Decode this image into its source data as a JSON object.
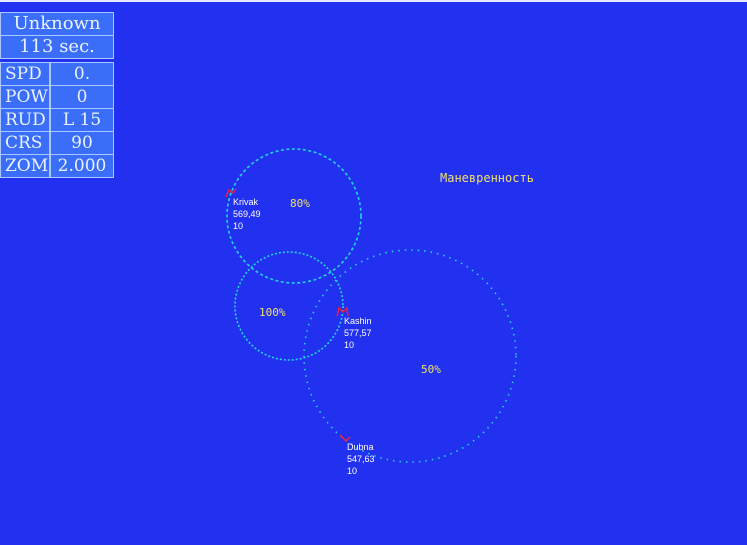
{
  "header": {
    "status": "Unknown",
    "timer": "113 sec."
  },
  "readouts": [
    {
      "key": "SPD",
      "value": "0."
    },
    {
      "key": "POW",
      "value": "0"
    },
    {
      "key": "RUD",
      "value": "L 15"
    },
    {
      "key": "CRS",
      "value": "90"
    },
    {
      "key": "ZOM",
      "value": "2.000"
    }
  ],
  "map_title": "Маневренность",
  "zones": [
    {
      "label": "80%",
      "color": "#22d4e6"
    },
    {
      "label": "100%",
      "color": "#22d4e6"
    },
    {
      "label": "50%",
      "color": "#22d4e6"
    }
  ],
  "ships": [
    {
      "name": "Krivak",
      "coords": "569,49",
      "value": "10",
      "marker_color": "#e0204a"
    },
    {
      "name": "Kashin",
      "coords": "577,57",
      "value": "10",
      "marker_color": "#e0204a"
    },
    {
      "name": "Dubna",
      "coords": "547,63",
      "value": "10",
      "marker_color": "#e0204a"
    }
  ]
}
